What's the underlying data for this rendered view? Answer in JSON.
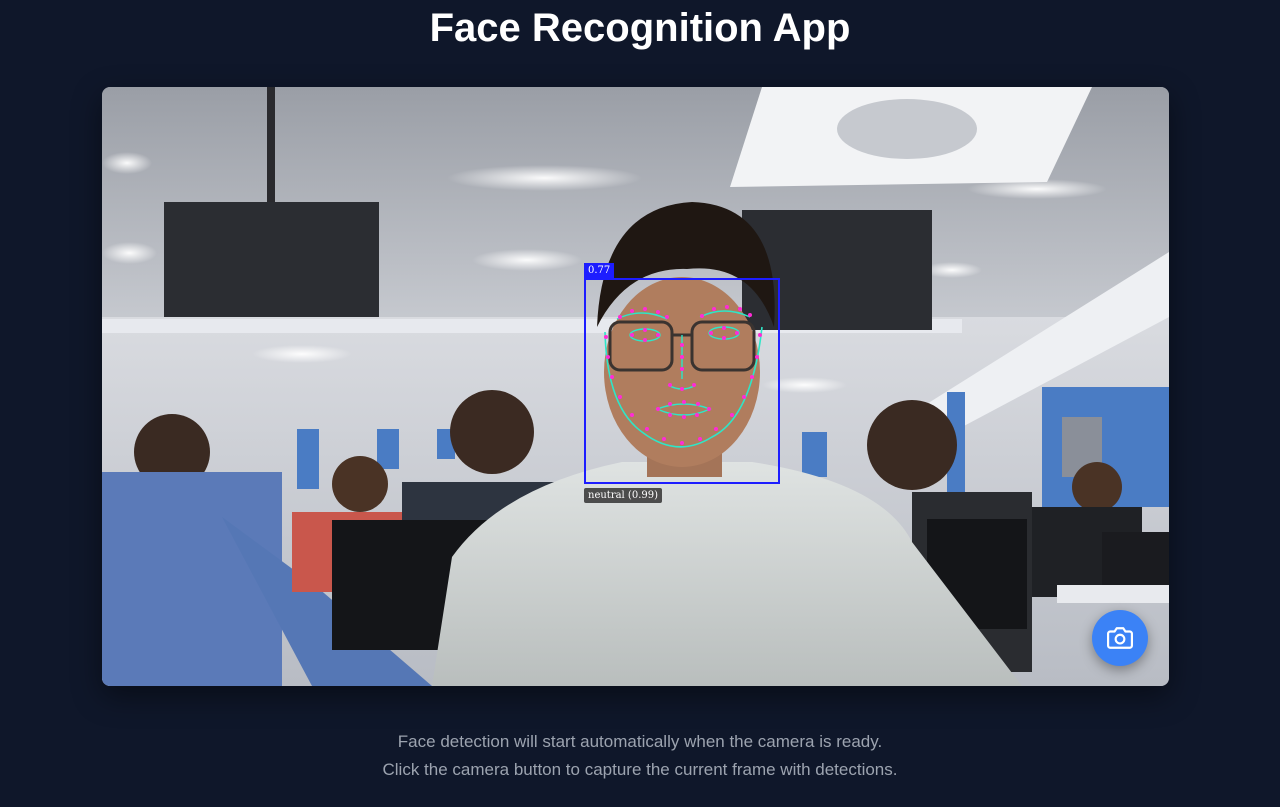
{
  "app": {
    "title": "Face Recognition App"
  },
  "camera": {
    "detection": {
      "score_label": "0.77",
      "expression_label": "neutral (0.99)",
      "box_color": "#1d1dff",
      "landmark_color": "#ff2bd6",
      "contour_color": "#2ee6c8"
    },
    "capture_button": {
      "icon": "camera-icon",
      "color": "#3b82f6"
    }
  },
  "instructions": {
    "line1": "Face detection will start automatically when the camera is ready.",
    "line2": "Click the camera button to capture the current frame with detections."
  }
}
